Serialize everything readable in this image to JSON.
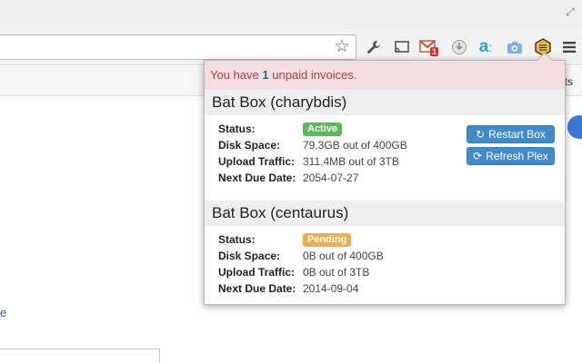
{
  "browser": {
    "expand_icon": "expand-icon",
    "star_icon": "star-icon",
    "bookmark_tail": "ts",
    "page_link": "e",
    "toolbar_icons": [
      "wrench-icon",
      "cast-icon",
      "gmail-icon",
      "download-icon",
      "amazon-icon",
      "camera-icon",
      "batbox-icon",
      "menu-icon"
    ],
    "gmail_badge": "1"
  },
  "alert": {
    "prefix": "You have",
    "count": "1",
    "suffix": "unpaid invoices."
  },
  "boxes": [
    {
      "title": "Bat Box (charybdis)",
      "status_label": "Status:",
      "status": "Active",
      "status_color": "#5cb85c",
      "disk_label": "Disk Space:",
      "disk": "79.3GB out of 400GB",
      "upload_label": "Upload Traffic:",
      "upload": "311.4MB out of 3TB",
      "due_label": "Next Due Date:",
      "due": "2054-07-27",
      "restart_label": "Restart Box",
      "refresh_label": "Refresh Plex"
    },
    {
      "title": "Bat Box (centaurus)",
      "status_label": "Status:",
      "status": "Pending",
      "status_color": "#f0ad4e",
      "disk_label": "Disk Space:",
      "disk": "0B out of 400GB",
      "upload_label": "Upload Traffic:",
      "upload": "0B out of 3TB",
      "due_label": "Next Due Date:",
      "due": "2014-09-04"
    }
  ],
  "colors": {
    "alert_bg": "#f2dede",
    "alert_text": "#a94442",
    "button": "#428bca"
  }
}
